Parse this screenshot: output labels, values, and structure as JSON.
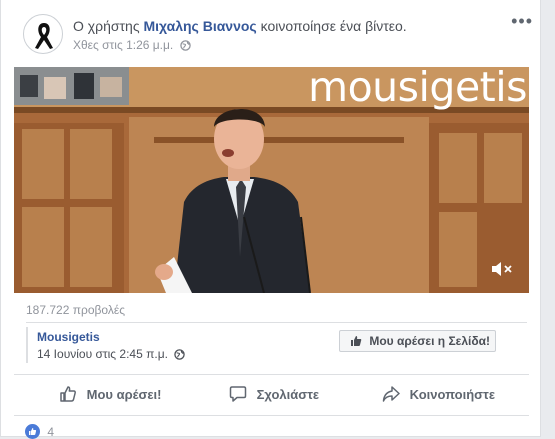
{
  "post": {
    "prefix": "Ο χρήστης",
    "author": "Μιχαλης Βιαννος",
    "suffix": "κοινοποίησε ένα βίντεο.",
    "timestamp": "Χθες στις 1:26 μ.μ.",
    "menu_icon": "more-options-icon",
    "privacy_icon": "globe-icon"
  },
  "video": {
    "watermark": "mousigetis",
    "mute_icon": "muted-speaker-icon"
  },
  "stats": {
    "views": "187.722 προβολές",
    "reaction_count": "4"
  },
  "shared_page": {
    "name": "Mousigetis",
    "time": "14 Ιουνίου στις 2:45 π.μ.",
    "like_page_label": "Μου αρέσει η Σελίδα!"
  },
  "actions": {
    "like": "Μου αρέσει!",
    "comment": "Σχολιάστε",
    "share": "Κοινοποιήστε"
  },
  "colors": {
    "link": "#365899",
    "muted": "#90949c",
    "background": "#e9ebee"
  }
}
